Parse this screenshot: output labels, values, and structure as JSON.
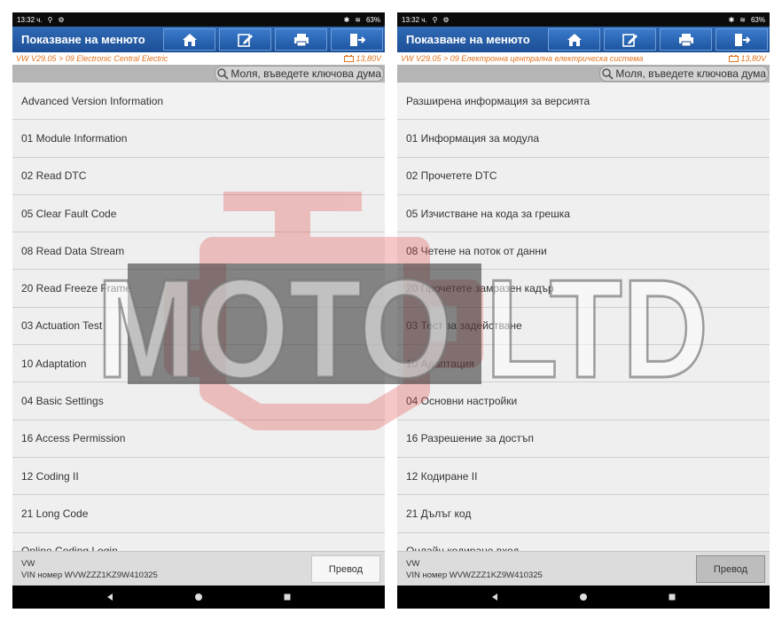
{
  "status_bar": {
    "time": "13:32 ч.",
    "battery": "63%"
  },
  "panels": [
    {
      "header_title": "Показване на менюто",
      "breadcrumb": "VW V29.05 > 09 Electronic Central Electric",
      "voltage": "13,80V",
      "search_placeholder": "Моля, въведете ключова дума",
      "items": [
        "Advanced Version Information",
        "01 Module Information",
        "02 Read DTC",
        "05 Clear Fault Code",
        "08 Read Data Stream",
        "20 Read Freeze Frame",
        "03 Actuation Test",
        "10 Adaptation",
        "04 Basic Settings",
        "16 Access Permission",
        "12 Coding II",
        "21 Long Code",
        "Online Coding Login"
      ],
      "vehicle": "VW",
      "vin": "VIN номер WVWZZZ1KZ9W410325",
      "translate_label": "Превод"
    },
    {
      "header_title": "Показване на менюто",
      "breadcrumb": "VW V29.05 > 09 Електронна централна електрическа система",
      "voltage": "13,80V",
      "search_placeholder": "Моля, въведете ключова дума",
      "items": [
        "Разширена информация за версията",
        "01 Информация за модула",
        "02 Прочетете DTC",
        "05 Изчистване на кода за грешка",
        "08 Четене на поток от данни",
        "20 Прочетете замразен кадър",
        "03 Тест за задействане",
        "10 Адаптация",
        "04 Основни настройки",
        "16 Разрешение за достъп",
        "12 Кодиране II",
        "21 Дълъг код",
        "Онлайн кодиране вход"
      ],
      "vehicle": "VW",
      "vin": "VIN номер WVWZZZ1KZ9W410325",
      "translate_label": "Превод"
    }
  ],
  "header_icons": [
    "home-icon",
    "edit-icon",
    "print-icon",
    "exit-icon"
  ],
  "watermark": "MOTO LTD",
  "colors": {
    "header_blue": "#1d4f96",
    "breadcrumb_orange": "#e2731e",
    "watermark_red": "#e24a4a"
  }
}
